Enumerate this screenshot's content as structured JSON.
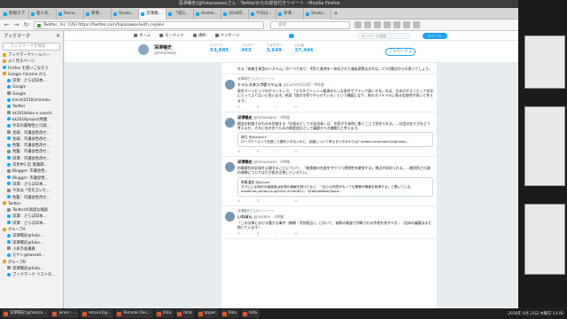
{
  "window": {
    "title": "深澤暢史(@fukazawas)さん｜Twitterからの返信付きツイート - Mozilla Firefox"
  },
  "tabs": [
    {
      "label": "新規タブ"
    },
    {
      "label": "超人気..."
    },
    {
      "label": "Reine..."
    },
    {
      "label": "新規..."
    },
    {
      "label": "Shuko..."
    },
    {
      "label": "深澤暢..."
    },
    {
      "label": "「成込..."
    },
    {
      "label": "Andrei..."
    },
    {
      "label": "2018年..."
    },
    {
      "label": "今日は..."
    },
    {
      "label": "深澤..."
    },
    {
      "label": "Shuko..."
    }
  ],
  "nav": {
    "url": "https://twitter.com/fukazawas/with_replies",
    "url_label": "Twitter, Inc. [US]",
    "search_placeholder": "検索"
  },
  "sidebar": {
    "title": "ブックマーク",
    "search_placeholder": "ブックマークを検索",
    "items": [
      "ブックマークツールバー",
      "よく見るページ",
      "Firefox を使いこなそう",
      "Google Chrome から",
      "深澤：さらば日本…",
      "Google",
      "Google",
      "kinshi2018ichimoku",
      "Twitter",
      "kk2018daio e naoshi",
      "kk2018project特集",
      "今日の薬物性と行政…",
      "金城：市議会性改セ…",
      "金城：市議会性改セ…",
      "色覧：市議会性改セ…",
      "色覧：市議会性改セ…",
      "深澤：市議会性改セ…",
      "深見中1 区 愛媛期…",
      "Blogger: 市議会性…",
      "Blogger: 市議会性…",
      "深澤：さらば日本…",
      "今日は「何を言いた…",
      "色覧：市議会性改セ…",
      "Twitter",
      "Twitterの高度な検索",
      "深澤：さらば日本…",
      "深澤：さらば日本…",
      "グループA",
      "深澤暢史@fuka…",
      "深澤暢史@fuka…",
      "小泉市会議員",
      "モヤシ@tweetd…",
      "グループB",
      "深澤暢史@fuka…",
      "ブックマーク リストの…"
    ]
  },
  "twitter": {
    "nav_home": "ホーム",
    "nav_moments": "モーメント",
    "nav_notifications": "通知",
    "nav_messages": "メッセージ",
    "search_placeholder": "キーワード検索",
    "tweet_button": "ツイート",
    "profile": {
      "name": "深澤暢史",
      "handle": "@fukazawas",
      "stats": [
        {
          "label": "ツイート",
          "value": "63,885"
        },
        {
          "label": "フォロー",
          "value": "463"
        },
        {
          "label": "フォロワー",
          "value": "3,649"
        },
        {
          "label": "いいね",
          "value": "27,446"
        }
      ],
      "follow_label": "フォローする"
    },
    "tweets": [
      {
        "context": "",
        "name": "",
        "meta": "",
        "body": "れる「病者主体型のシステム」の一つであり、予防と救済を一体化させた福祉政策なのかは。2つの観点からの思いでしょう。",
        "quote": null
      },
      {
        "context": "深澤暢史さんがリツイート",
        "name": "トイレスタンプ＠リツェル",
        "meta": "@Commit3180 · 6時間",
        "body": "東京オリンピックのボランティア、「エスタブリッシュ層達みたいな条件でブラック扱いする」のは、日本のボランティア文化にとってよくないと思います。結局「国の主導でやらせている」という構図になり、負のスパイラルに陥る危険性が高いと考えます。",
        "quote": null
      },
      {
        "context": "",
        "name": "深澤暢史",
        "meta": "@fukazawas · 4時間",
        "body": "都会の制度そのものを評価する「仕組みとしての自治体」は、市民が主体的に動くことで形作られる。…社会の在り方をどう考えるか、それに向き合うための制度設計として議論すべき課題だと考えます。",
        "quote": {
          "header": "毎日 @mainichi",
          "body": "ローズクールって支援した額を入れないのに、結婚について考えるべきなのでは? twitter.com/mainichijpnews..."
        }
      },
      {
        "context": "",
        "name": "深澤暢史",
        "meta": "@fukazawas · 4時間",
        "body": "刑事裁判の記録を公開することについて、「被害者の名誉を守りつつ透明性を確保する」視点が求められる。…裁判所と行政の連携については引き続き注視していきたい。",
        "quote": {
          "header": "時事通信 @jijicom",
          "body": "すでにいる時代の被疑者は仮想の通報を受けたなど、「自らの同意がなくても警察が情報を取得する」と聞いている。headlines.yahoo.co.jp/hl?a=20180621... @YahooNewsTopics"
        }
      },
      {
        "context": "深澤暢史さんがリツイート",
        "name": "いわぼん",
        "meta": "@iwabon · 2時間",
        "body": "「この法律における重大な事件（無期・死刑相当）」において、検察の裁量で判断される余地を残すべき…（全体の議論はまだ続いています）",
        "quote": null
      }
    ]
  },
  "taskbar": {
    "items": [
      "深澤暢史(@fukaza...",
      "jenes - ...",
      "emacs2@...",
      "Remote Des...",
      "tilda",
      "tilda",
      "qapes",
      "tilda",
      "tilda"
    ],
    "clock": "2018年 6月 21日 木曜日 15:09"
  }
}
